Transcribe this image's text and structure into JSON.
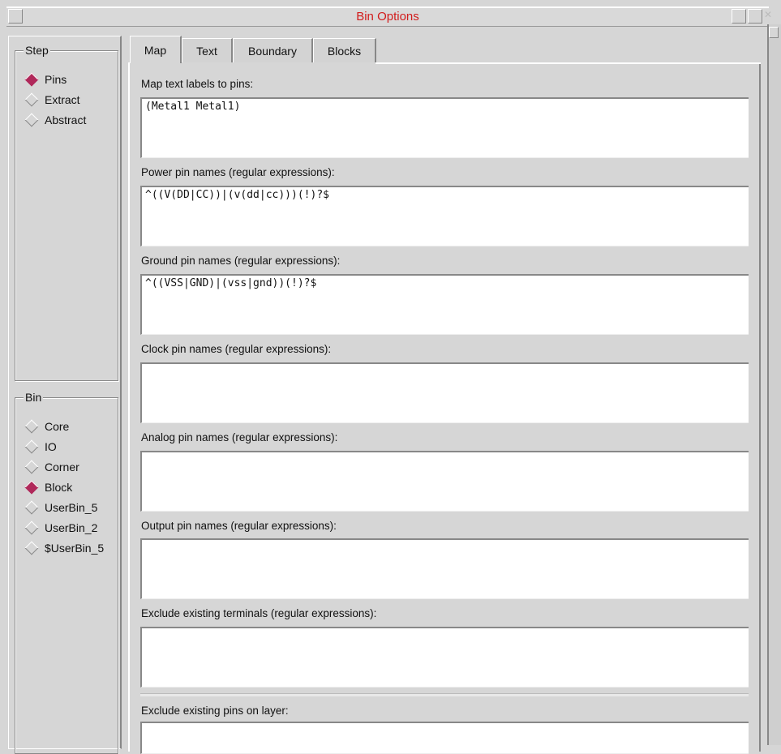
{
  "window": {
    "title": "Bin Options"
  },
  "step": {
    "label": "Step",
    "options": [
      {
        "label": "Pins",
        "selected": true
      },
      {
        "label": "Extract",
        "selected": false
      },
      {
        "label": "Abstract",
        "selected": false
      }
    ]
  },
  "bin": {
    "label": "Bin",
    "options": [
      {
        "label": "Core",
        "selected": false
      },
      {
        "label": "IO",
        "selected": false
      },
      {
        "label": "Corner",
        "selected": false
      },
      {
        "label": "Block",
        "selected": true
      },
      {
        "label": "UserBin_5",
        "selected": false
      },
      {
        "label": "UserBin_2",
        "selected": false
      },
      {
        "label": "$UserBin_5",
        "selected": false
      }
    ]
  },
  "tabs": [
    {
      "label": "Map",
      "active": true
    },
    {
      "label": "Text",
      "active": false
    },
    {
      "label": "Boundary",
      "active": false
    },
    {
      "label": "Blocks",
      "active": false
    }
  ],
  "fields": [
    {
      "label": "Map text labels to pins:",
      "value": "(Metal1 Metal1)"
    },
    {
      "label": "Power pin names (regular expressions):",
      "value": "^((V(DD|CC))|(v(dd|cc)))(!)?$"
    },
    {
      "label": "Ground pin names (regular expressions):",
      "value": "^((VSS|GND)|(vss|gnd))(!)?$"
    },
    {
      "label": "Clock pin names (regular expressions):",
      "value": ""
    },
    {
      "label": "Analog pin names (regular expressions):",
      "value": ""
    },
    {
      "label": "Output pin names (regular expressions):",
      "value": ""
    },
    {
      "label": "Exclude existing terminals (regular expressions):",
      "value": ""
    },
    {
      "label": "Exclude existing pins on layer:",
      "value": ""
    }
  ],
  "colors": {
    "title": "#d21c1c",
    "radio_selected": "#b0285a"
  }
}
